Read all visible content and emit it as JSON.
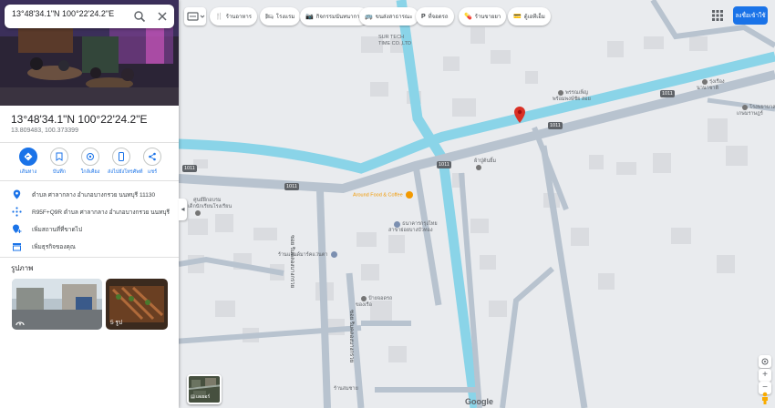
{
  "search": {
    "value": "13°48'34.1\"N 100°22'24.2\"E"
  },
  "place": {
    "title": "13°48'34.1\"N 100°22'24.2\"E",
    "decimal": "13.809483, 100.373399"
  },
  "actions": [
    {
      "label": "เส้นทาง",
      "icon": "directions-icon"
    },
    {
      "label": "บันทึก",
      "icon": "bookmark-icon"
    },
    {
      "label": "ใกล้เคียง",
      "icon": "nearby-icon"
    },
    {
      "label": "ส่งไปยังโทรศัพท์",
      "icon": "send-to-phone-icon"
    },
    {
      "label": "แชร์",
      "icon": "share-icon"
    }
  ],
  "info_rows": [
    {
      "text": "ตำบล ศาลากลาง อำเภอบางกรวย นนทบุรี 11130",
      "icon": "location-pin-icon"
    },
    {
      "text": "R95F+Q9R ตำบล ศาลากลาง อำเภอบางกรวย นนทบุรี",
      "icon": "plus-code-icon"
    },
    {
      "text": "เพิ่มสถานที่ที่ขาดไป",
      "icon": "add-place-icon"
    },
    {
      "text": "เพิ่มธุรกิจของคุณ",
      "icon": "add-business-icon"
    }
  ],
  "photos": {
    "heading": "รูปภาพ",
    "items": [
      {
        "caption": "",
        "icon": "street-view-icon"
      },
      {
        "caption": "5 รูป",
        "icon": "photo-icon"
      }
    ]
  },
  "chips": [
    {
      "label": "ร้านอาหาร",
      "icon": "restaurant-icon"
    },
    {
      "label": "โรงแรม",
      "icon": "hotel-icon"
    },
    {
      "label": "กิจกรรมนันทนาการ",
      "icon": "camera-icon"
    },
    {
      "label": "ขนส่งสาธารณะ",
      "icon": "transit-icon"
    },
    {
      "label": "ที่จอดรถ",
      "icon": "parking-icon"
    },
    {
      "label": "ร้านขายยา",
      "icon": "pharmacy-icon"
    },
    {
      "label": "ตู้เอทีเอ็ม",
      "icon": "atm-icon"
    }
  ],
  "signin_label": "ลงชื่อเข้าใช้",
  "map_labels": {
    "tech": "SUR TECH\nTIME CO.,LTD",
    "road_1011_a": "1011",
    "road_1011_b": "1011",
    "road_1011_c": "1011",
    "road_1011_d": "1011",
    "road_1011_e": "1011",
    "poi_shop": "พรรณเพ็ญ\nพร้อมพงษ์ชัย สอย",
    "poi_shop2": "รุ่งเรือง\nนานาชาติ",
    "poi_right": "โรงพยาบาล\nเกษมราษฎร์",
    "poi_mid": "ผ้าปู่ต้นยิ้ม",
    "poi_left": "ศูนย์ฝึกอบรม\nเด็กนักเรียนโรงเรียน",
    "food": "Around Food & Coffee",
    "bank": "ธนาคารกรุงไทย\nสาขาย่อยบางบัวทอง",
    "soi_v1": "ซอย ริมคลองบางกรวย",
    "soi_v2": "ซอย ริมคลองบางกรวย",
    "shop_bottom": "ร้านสมชาย",
    "poi_water": "ป้ายจอดรถ\nของเรือ",
    "chain": "ร้านแลนด์มาร์คแว่นตา",
    "layer_label": "เลเยอร์",
    "google": "Google"
  },
  "colors": {
    "canal": "#8ad4e8",
    "road": "#b8c3cf",
    "map_bg": "#e9ebee",
    "accent": "#1a73e8",
    "pin": "#d93025",
    "food": "#f29900"
  }
}
